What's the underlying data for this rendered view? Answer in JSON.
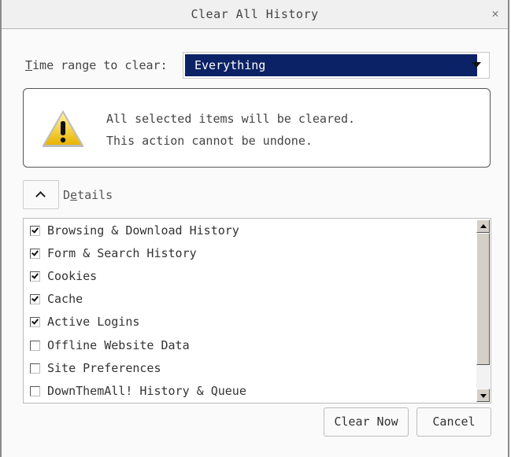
{
  "window": {
    "title": "Clear All History",
    "close_icon": "close-icon"
  },
  "time_range": {
    "label_accel": "T",
    "label_rest": "ime range to clear:",
    "selected": "Everything"
  },
  "warning": {
    "icon": "warning-triangle-icon",
    "line1": "All selected items will be cleared.",
    "line2": "This action cannot be undone."
  },
  "details": {
    "toggle_icon": "chevron-up-icon",
    "label_pre": "D",
    "label_accel": "e",
    "label_post": "tails"
  },
  "items": [
    {
      "label": "Browsing & Download History",
      "checked": true
    },
    {
      "label": "Form & Search History",
      "checked": true
    },
    {
      "label": "Cookies",
      "checked": true
    },
    {
      "label": "Cache",
      "checked": true
    },
    {
      "label": "Active Logins",
      "checked": true
    },
    {
      "label": "Offline Website Data",
      "checked": false
    },
    {
      "label": "Site Preferences",
      "checked": false
    },
    {
      "label": "DownThemAll! History & Queue",
      "checked": false
    }
  ],
  "buttons": {
    "clear_now": "Clear Now",
    "cancel": "Cancel"
  }
}
